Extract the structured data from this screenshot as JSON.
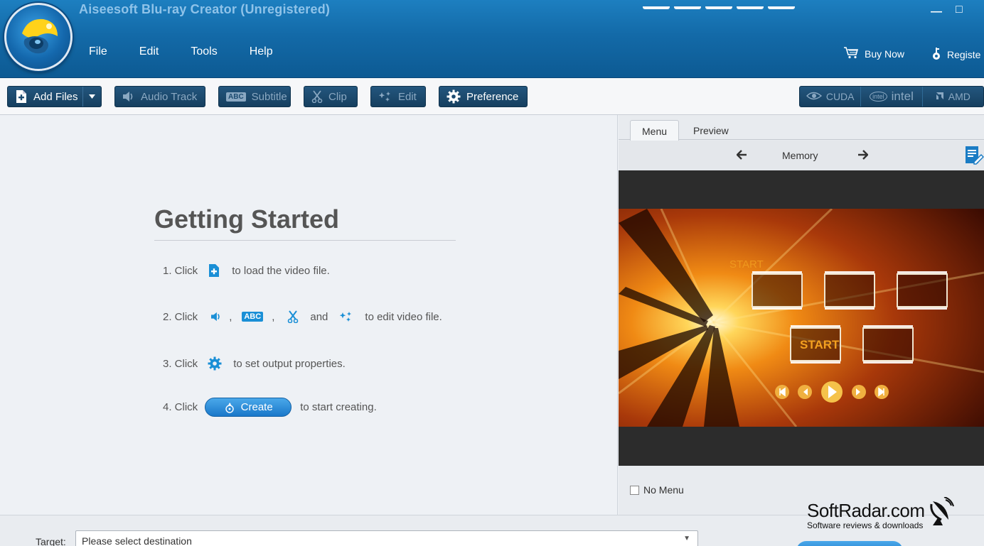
{
  "window": {
    "title": "Aiseesoft Blu-ray Creator (Unregistered)",
    "minimize": "—",
    "maximize": "□"
  },
  "menu": [
    "File",
    "Edit",
    "Tools",
    "Help"
  ],
  "header_links": {
    "buy_now": "Buy Now",
    "register": "Registe"
  },
  "toolbar": {
    "add_files": "Add Files",
    "audio_track": "Audio Track",
    "subtitle": "Subtitle",
    "subtitle_icon_text": "ABC",
    "clip": "Clip",
    "edit": "Edit",
    "preference": "Preference",
    "cuda": "CUDA",
    "intel_badge": "intel",
    "intel": "intel",
    "amd": "AMD"
  },
  "getting_started": {
    "title": "Getting Started",
    "step1": {
      "prefix": "1. Click",
      "suffix": "to load the video file."
    },
    "step2": {
      "prefix": "2. Click",
      "sep1": ",",
      "sep2": ",",
      "and": "and",
      "abc": "ABC",
      "suffix": "to edit video file."
    },
    "step3": {
      "prefix": "3. Click",
      "suffix": "to set output properties."
    },
    "step4": {
      "prefix": "4. Click",
      "button": "Create",
      "suffix": "to start creating."
    }
  },
  "menu_panel": {
    "tabs": [
      "Menu",
      "Preview"
    ],
    "active_tab": "Menu",
    "template_name": "Memory",
    "preview_start_big": "START",
    "preview_start_small": "START",
    "no_menu_label": "No Menu",
    "no_menu_checked": false
  },
  "bottom": {
    "target_label": "Target:",
    "target_placeholder": "Please select destination"
  },
  "watermark": {
    "brand": "SoftRadar.com",
    "tagline": "Software reviews & downloads"
  },
  "colors": {
    "title_bar": "#136aa8",
    "toolbar_button": "#1b4a70",
    "accent_icon": "#1a8fd6",
    "create_button": "#2a8bd8"
  },
  "icons": {
    "add_files": "add-file-icon",
    "audio_track": "speaker-icon",
    "subtitle": "abc-icon",
    "clip": "scissors-icon",
    "edit": "sparkle-icon",
    "preference": "gear-icon",
    "buy_now": "cart-icon",
    "register": "key-icon"
  }
}
